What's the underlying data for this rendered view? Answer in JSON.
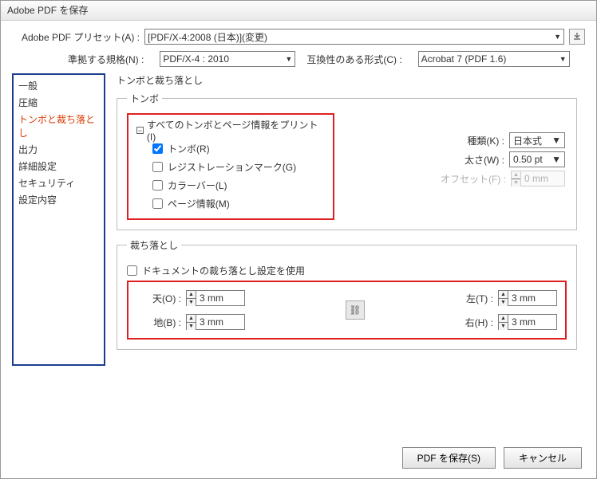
{
  "window": {
    "title": "Adobe PDF を保存"
  },
  "preset": {
    "label": "Adobe PDF プリセット(A) :",
    "value": "[PDF/X-4:2008 (日本)](変更)"
  },
  "standard": {
    "label": "準拠する規格(N) :",
    "value": "PDF/X-4 : 2010"
  },
  "compat": {
    "label": "互換性のある形式(C) :",
    "value": "Acrobat 7 (PDF 1.6)"
  },
  "sidebar": {
    "items": [
      "一般",
      "圧縮",
      "トンボと裁ち落とし",
      "出力",
      "詳細設定",
      "セキュリティ",
      "設定内容"
    ],
    "selected": 2
  },
  "panel": {
    "title": "トンボと裁ち落とし"
  },
  "marks": {
    "legend": "トンボ",
    "all_label": "すべてのトンボとページ情報をプリント(I)",
    "trim_label": "トンボ(R)",
    "reg_label": "レジストレーションマーク(G)",
    "color_label": "カラーバー(L)",
    "page_label": "ページ情報(M)",
    "type_label": "種類(K) :",
    "type_value": "日本式",
    "weight_label": "太さ(W) :",
    "weight_value": "0.50 pt",
    "offset_label": "オフセット(F) :",
    "offset_value": "0 mm"
  },
  "bleed": {
    "legend": "裁ち落とし",
    "use_doc_label": "ドキュメントの裁ち落とし設定を使用",
    "top_label": "天(O) :",
    "top_value": "3 mm",
    "bottom_label": "地(B) :",
    "bottom_value": "3 mm",
    "left_label": "左(T) :",
    "left_value": "3 mm",
    "right_label": "右(H) :",
    "right_value": "3 mm"
  },
  "footer": {
    "save": "PDF を保存(S)",
    "cancel": "キャンセル"
  }
}
